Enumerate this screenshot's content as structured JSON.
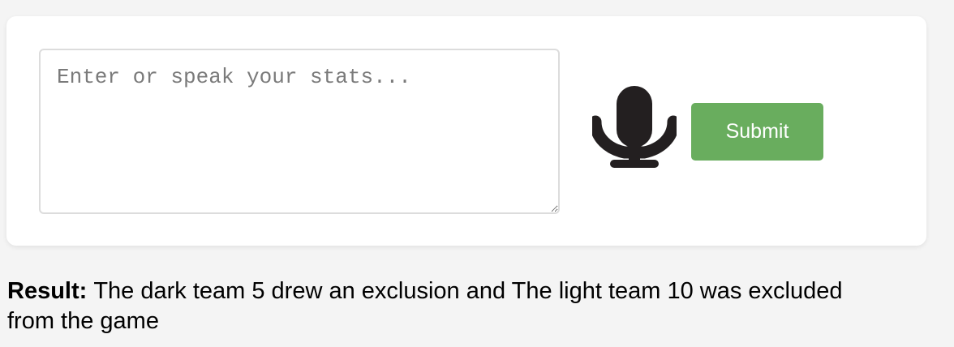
{
  "input": {
    "placeholder": "Enter or speak your stats...",
    "value": ""
  },
  "mic": {
    "icon": "microphone-icon",
    "color": "#231f20"
  },
  "submit": {
    "label": "Submit",
    "color": "#69ad5e"
  },
  "result": {
    "label": "Result:",
    "text": "The dark team 5 drew an exclusion and The light team 10 was excluded from the game"
  }
}
